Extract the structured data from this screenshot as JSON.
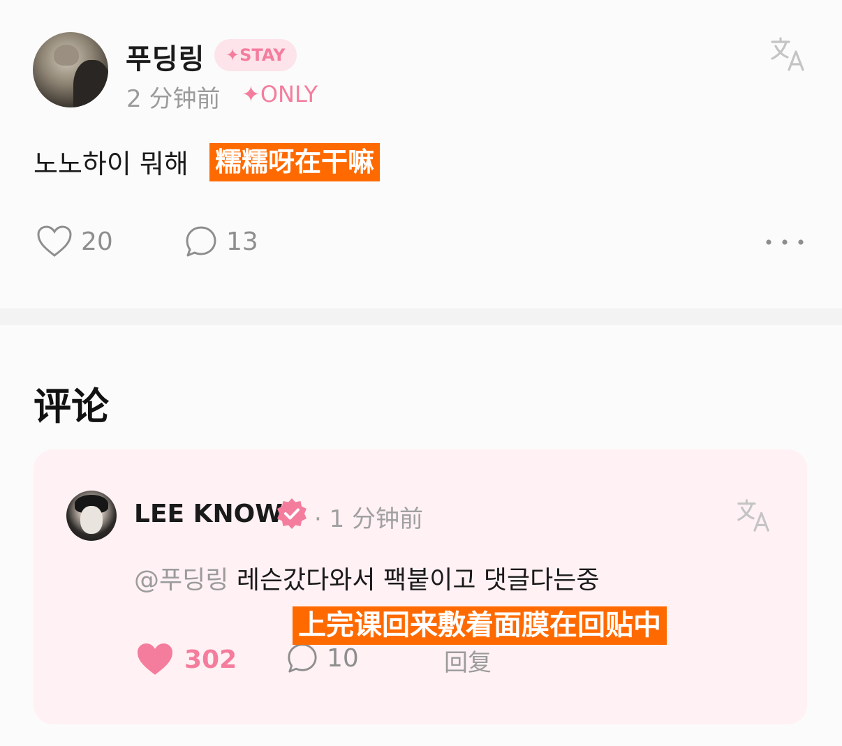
{
  "post": {
    "author": "푸딩링",
    "badge": "✦STAY",
    "time": "2 分钟前",
    "membership_tag": "✦ONLY",
    "text": "노노하이 뭐해",
    "subtitle": "糯糯呀在干嘛",
    "likes": "20",
    "comments": "13"
  },
  "section_title": "评论",
  "comment": {
    "author": "LEE KNOW",
    "time": "· 1 分钟前",
    "mention": "@푸딩링",
    "text": " 레슨갔다와서 팩붙이고 댓글다는중",
    "subtitle": "上完课回来敷着面膜在回贴中",
    "likes": "302",
    "comments": "10",
    "reply_label": "回复",
    "liked": true
  },
  "icons": {
    "translate": "translate-icon",
    "heart": "heart-icon",
    "comment": "comment-bubble-icon",
    "more": "more-dots-icon",
    "verified": "verified-badge-icon"
  },
  "colors": {
    "accent_pink": "#f47d9d",
    "subtitle_bg": "#ff6a00",
    "card_bg": "#fff1f4"
  }
}
